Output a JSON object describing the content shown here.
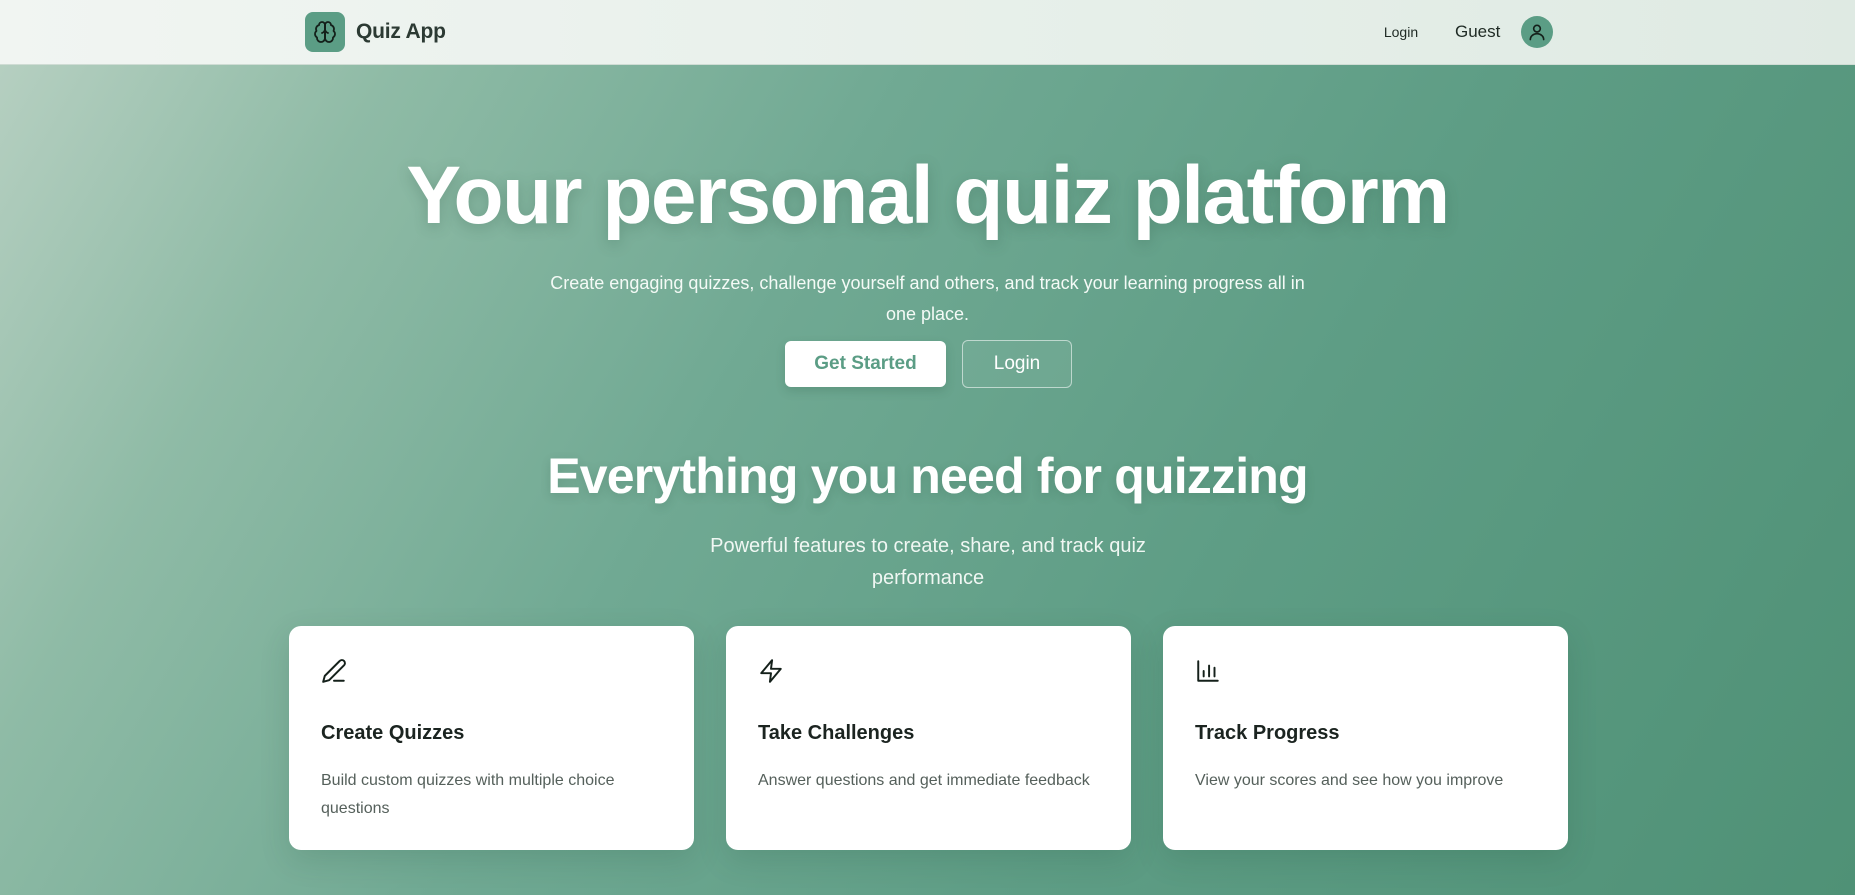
{
  "navbar": {
    "brand_name": "Quiz App",
    "brand_icon": "brain-icon",
    "login_label": "Login",
    "user_label": "Guest",
    "avatar_icon": "user-icon"
  },
  "hero": {
    "title": "Your personal quiz platform",
    "subtitle": "Create engaging quizzes, challenge yourself and others, and track your learning progress all in one place.",
    "primary_button": "Get Started",
    "secondary_button": "Login"
  },
  "features": {
    "title": "Everything you need for quizzing",
    "subtitle": "Powerful features to create, share, and track quiz performance",
    "cards": [
      {
        "icon": "pencil-icon",
        "title": "Create Quizzes",
        "description": "Build custom quizzes with multiple choice questions"
      },
      {
        "icon": "lightning-icon",
        "title": "Take Challenges",
        "description": "Answer questions and get immediate feedback"
      },
      {
        "icon": "bar-chart-icon",
        "title": "Track Progress",
        "description": "View your scores and see how you improve"
      }
    ]
  },
  "colors": {
    "brand": "#5b9d85",
    "background_start": "#b9d1c3",
    "background_end": "#4f9176",
    "card": "#ffffff"
  }
}
